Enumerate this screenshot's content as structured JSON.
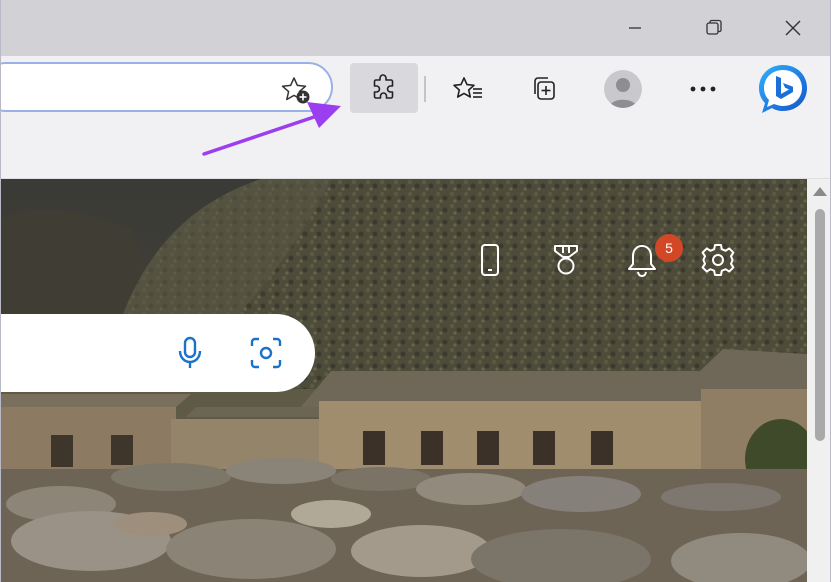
{
  "window_controls": {
    "minimize_icon": "minimize-icon",
    "restore_icon": "restore-icon",
    "close_icon": "close-icon"
  },
  "toolbar": {
    "address_bar_value": "",
    "favorite_add_icon": "star-plus-icon",
    "extensions_icon": "puzzle-icon",
    "favorites_icon": "star-list-icon",
    "collections_icon": "collections-icon",
    "profile_icon": "avatar-icon",
    "more_icon": "ellipsis-icon",
    "copilot_icon": "bing-chat-icon",
    "extensions_active": true
  },
  "page": {
    "header_icons": [
      "phone-icon",
      "medal-icon",
      "bell-icon",
      "gear-icon"
    ],
    "notification_count": "5",
    "search": {
      "value": "",
      "voice_icon": "microphone-icon",
      "visual_search_icon": "camera-search-icon"
    }
  },
  "colors": {
    "accent_arrow": "#9b3ef0",
    "badge": "#d24726",
    "search_icon_blue": "#1a73c9"
  }
}
